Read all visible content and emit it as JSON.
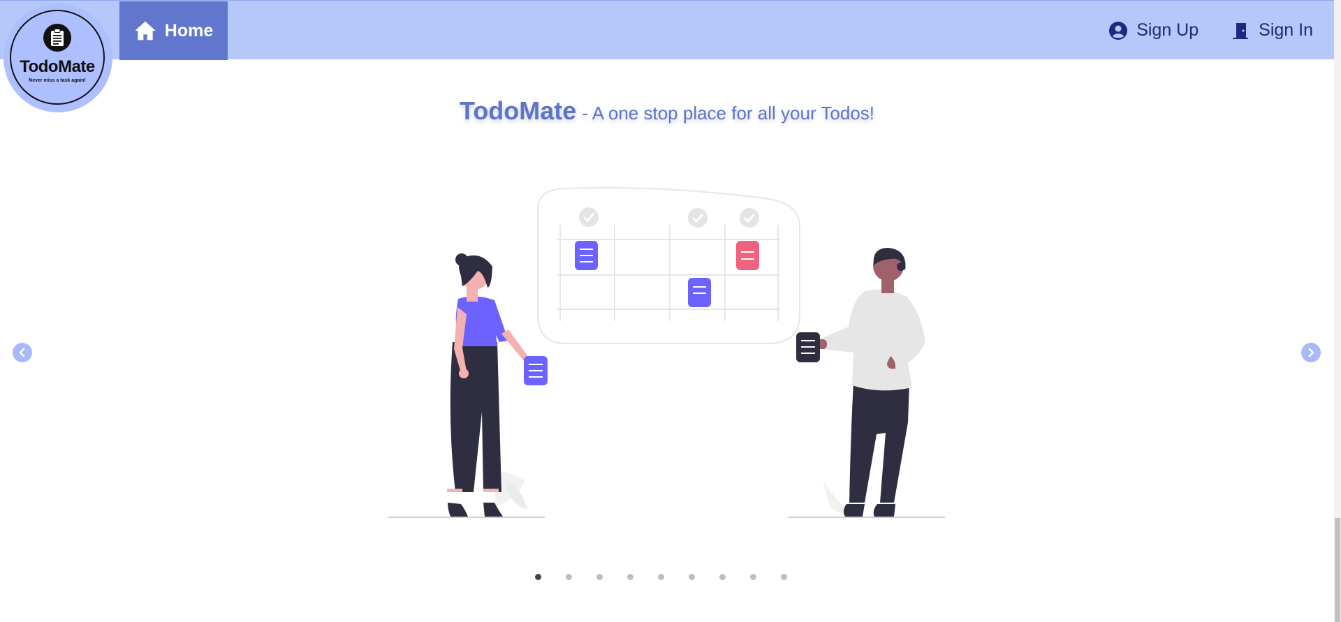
{
  "nav": {
    "home_label": "Home",
    "signup_label": "Sign Up",
    "signin_label": "Sign In"
  },
  "logo": {
    "name": "TodoMate",
    "tagline": "Never miss a task again!"
  },
  "hero": {
    "brand": "TodoMate",
    "tagline": "- A one stop place for all your Todos!"
  },
  "carousel": {
    "slide_count": 9,
    "active_index": 0
  },
  "icons": {
    "home": "home-icon",
    "signup": "user-circle-icon",
    "signin": "door-icon",
    "prev": "chevron-left-icon",
    "next": "chevron-right-icon"
  },
  "colors": {
    "navbar": "#b6c7fa",
    "accent": "#6077cd",
    "nav_text": "#1a2a80",
    "headline": "#5d74c8",
    "purple": "#6c63ff",
    "pink": "#f06280"
  }
}
